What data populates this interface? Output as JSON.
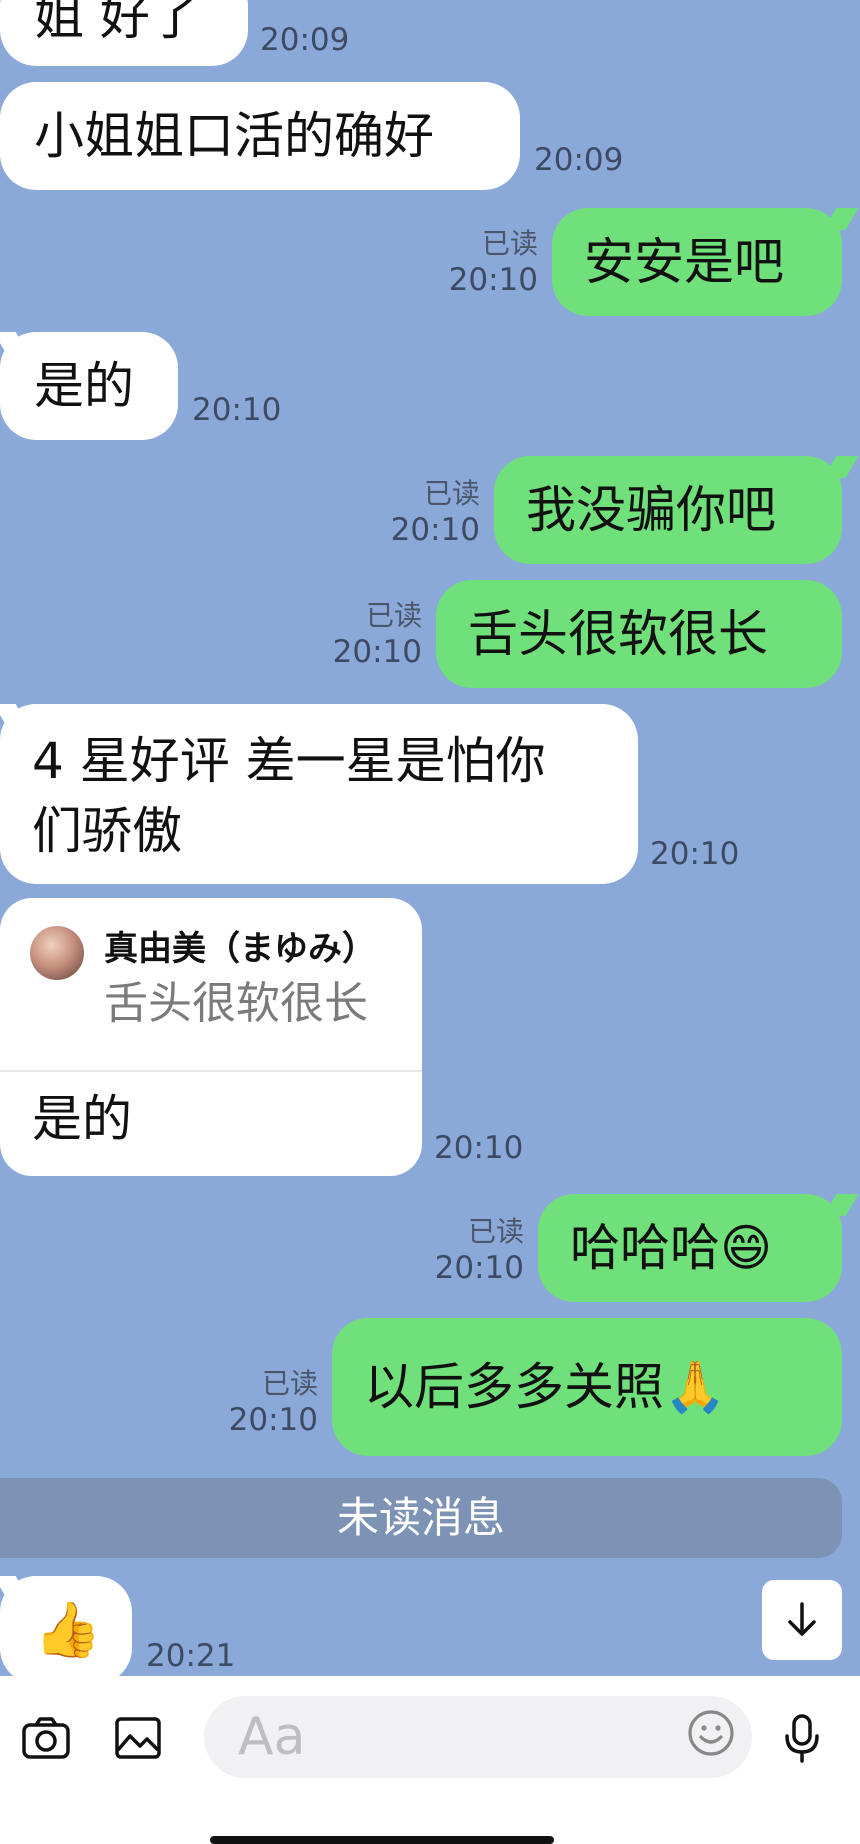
{
  "messages": [
    {
      "text": "姐 好了",
      "time": "20:09"
    },
    {
      "text": "小姐姐口活的确好",
      "time": "20:09"
    },
    {
      "text": "安安是吧",
      "read": "已读",
      "time": "20:10"
    },
    {
      "text": "是的",
      "time": "20:10"
    },
    {
      "text": "我没骗你吧",
      "read": "已读",
      "time": "20:10"
    },
    {
      "text": "舌头很软很长",
      "read": "已读",
      "time": "20:10"
    },
    {
      "line1": "4 星好评 差一星是怕你",
      "line2": "们骄傲",
      "time": "20:10"
    },
    {
      "quote_name": "真由美（まゆみ）",
      "quote_text": "舌头很软很长",
      "text": "是的",
      "time": "20:10"
    },
    {
      "text": "哈哈哈😄",
      "read": "已读",
      "time": "20:10"
    },
    {
      "text": "以后多多关照🙏",
      "read": "已读",
      "time": "20:10"
    },
    {
      "text": "👍",
      "time": "20:21"
    }
  ],
  "unread_banner": "未读消息",
  "input": {
    "placeholder": "Aa"
  },
  "icons": {
    "camera": "camera-icon",
    "image": "image-icon",
    "emoji": "emoji-icon",
    "mic": "microphone-icon",
    "scroll": "arrow-down-icon"
  },
  "colors": {
    "background": "#8aa9d9",
    "incoming": "#ffffff",
    "outgoing": "#6fe07a"
  }
}
